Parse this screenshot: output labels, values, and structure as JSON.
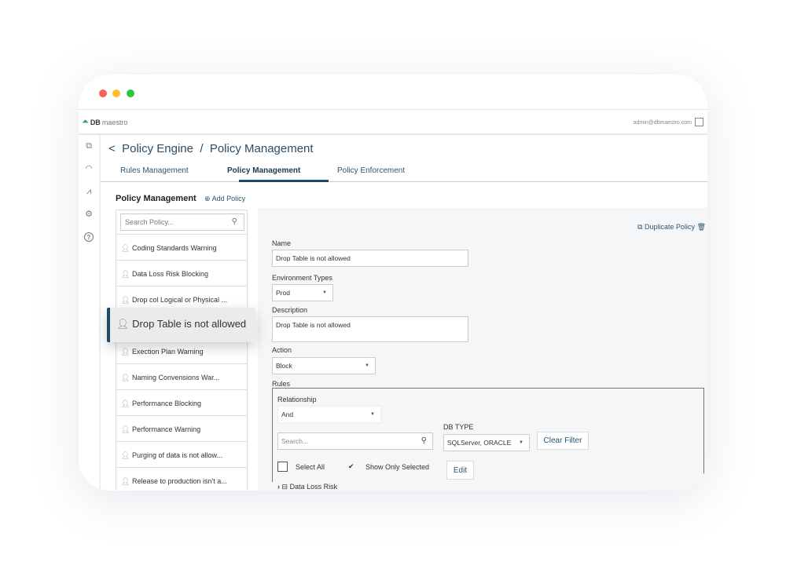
{
  "window": {
    "dots": [
      "#fe5f57",
      "#febc2e",
      "#28c840"
    ]
  },
  "app": {
    "logo_bold": "DB",
    "logo_rest": "maestro",
    "user": "admin@dbmaestro.com"
  },
  "breadcrumb": {
    "back": "<",
    "text": "Policy Engine  /  Policy Management"
  },
  "tabs": [
    "Rules Management",
    "Policy Management",
    "Policy Enforcement"
  ],
  "list": {
    "title": "Policy Management",
    "add_label": "Add Policy",
    "search_placeholder": "Search Policy...",
    "items": [
      "Coding Standards Warning",
      "Data Loss Risk Blocking",
      "Drop col Logical or Physical ...",
      "Drop Table is not allowed",
      "Exection Plan Warning",
      "Naming Convensions War...",
      "Performance Blocking",
      "Performance Warning",
      "Purging of data is not allow...",
      "Release to production isn't a..."
    ],
    "selected": "Drop Table is not allowed"
  },
  "form": {
    "duplicate_label": "Duplicate Policy",
    "name_label": "Name",
    "name_value": "Drop Table is not allowed",
    "env_label": "Environment Types",
    "env_value": "Prod",
    "desc_label": "Description",
    "desc_value": "Drop Table is not allowed",
    "action_label": "Action",
    "action_value": "Block",
    "rules_label": "Rules"
  },
  "rules": {
    "relationship_label": "Relationship",
    "relationship_value": "And",
    "search_placeholder": "Search...",
    "dbtype_label": "DB TYPE",
    "dbtype_value": "SQLServer, ORACLE",
    "clear_filter": "Clear Filter",
    "select_all": "Select All",
    "show_only_selected": "Show Only Selected",
    "edit": "Edit",
    "tree_item": "Data Loss Risk"
  }
}
